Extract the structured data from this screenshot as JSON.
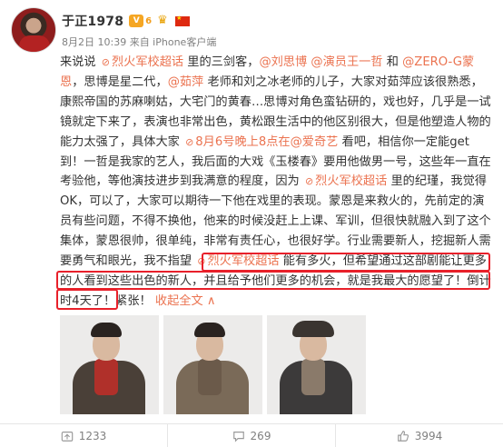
{
  "user": {
    "name": "于正1978",
    "vip_badge": "V",
    "vip_level": "6",
    "crown": "♛"
  },
  "meta": {
    "time_source": "8月2日 10:39 来自 iPhone客户端"
  },
  "post": {
    "l1_a": "来说说 ",
    "tag1": "烈火军校超话",
    "l1_b": " 里的三剑客，",
    "at1": "@刘思博",
    "l1_c": " ",
    "at2": "@演员王一哲",
    "l1_d": " 和 ",
    "at3": "@ZERO-G蒙恩",
    "l2_a": "，思博是星二代，",
    "at4": "@茹萍",
    "l2_b": " 老师和刘之冰老师的儿子，大家对茹萍应该很熟悉，康熙帝国的苏麻喇姑，大宅门的黄春…思博对角色蛮钻研的，戏也好，几乎是一试镜就定下来了，表演也非常出色，黄松跟生活中的他区别很大，但是他塑造人物的能力太强了，具体大家 ",
    "tag2": "8月6号晚上8点在@爱奇艺",
    "l6_b": " 看吧，相信你一定能get到！一哲是我家的艺人，我后面的大戏《玉楼春》要用他做男一号，这些年一直在考验他，等他演技进步到我满意的程度，因为 ",
    "tag3": "烈火军校超话",
    "l8_b": " 里的纪瑾，我觉得OK，可以了，大家可以期待一下他在戏里的表现。蒙恩是来救火的，先前定的演员有些问题，不得不换他，他来的时候没赶上上课、军训，但很快就融入到了这个集体，蒙恩很帅，很单纯，非常有责任心，也很好学。行业需要新人，挖掘新人需要勇气和眼光，我不指望 ",
    "tag4": "烈火军校超话",
    "l12_b": " 能有多火，但希望通过这部剧能让更多的人看到这些出色的新人，并且给予他们更多的机会，就是我最大的愿望了！倒计时4天了！紧张！",
    "expand": "收起全文",
    "expand_arrow": "∧"
  },
  "actions": {
    "share_count": "1233",
    "comment_count": "269",
    "like_count": "3994"
  },
  "colors": {
    "link": "#eb7350",
    "highlight_box": "#e8202a"
  }
}
